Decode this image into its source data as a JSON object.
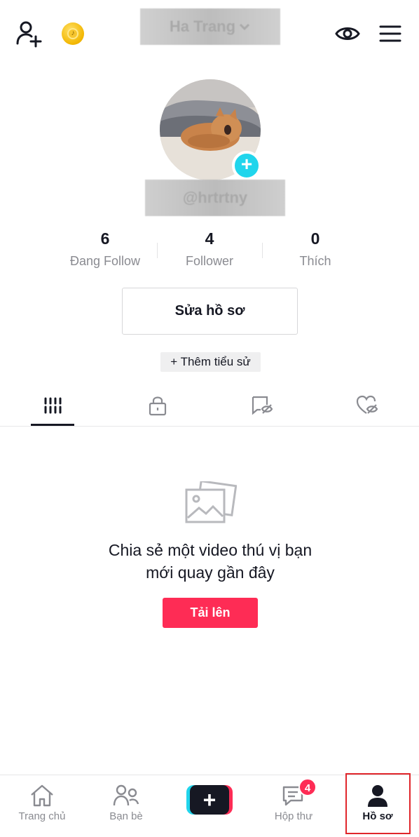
{
  "header": {
    "username": "Ha Trang",
    "icons": [
      "add-user-icon",
      "coin-icon",
      "chevron-down-icon",
      "eye-icon",
      "menu-icon"
    ]
  },
  "profile": {
    "handle": "@hrtrtny",
    "stats": [
      {
        "value": "6",
        "label": "Đang Follow"
      },
      {
        "value": "4",
        "label": "Follower"
      },
      {
        "value": "0",
        "label": "Thích"
      }
    ],
    "edit_label": "Sửa hồ sơ",
    "bio_label": "+ Thêm tiểu sử"
  },
  "tabs": [
    {
      "icon": "grid-icon",
      "active": true
    },
    {
      "icon": "lock-icon",
      "active": false
    },
    {
      "icon": "hidden-repost-icon",
      "active": false
    },
    {
      "icon": "hidden-heart-icon",
      "active": false
    }
  ],
  "empty_state": {
    "line1": "Chia sẻ một video thú vị bạn",
    "line2": "mới quay gần đây",
    "button_label": "Tải lên"
  },
  "bottom_nav": {
    "home": "Trang chủ",
    "friends": "Bạn bè",
    "inbox": "Hộp thư",
    "inbox_badge": "4",
    "profile": "Hồ sơ"
  },
  "colors": {
    "accent_red": "#fe2c55",
    "accent_cyan": "#20d5ec",
    "text_primary": "#161823",
    "text_secondary": "#8a8b91",
    "highlight_box": "#e0262b"
  }
}
